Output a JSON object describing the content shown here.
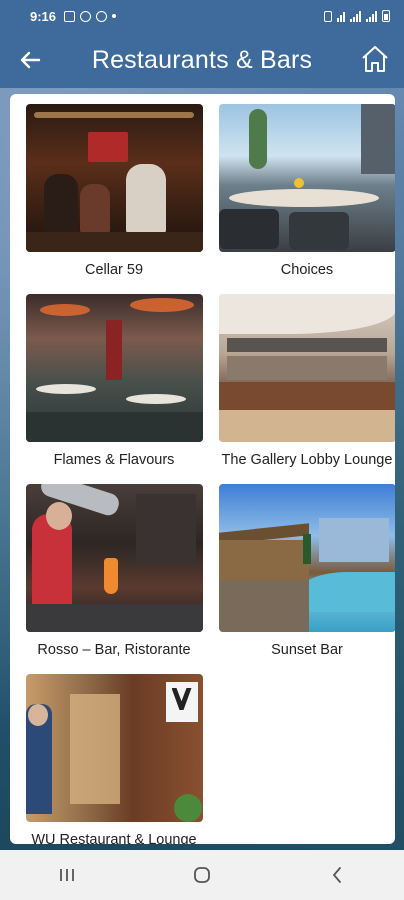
{
  "status_bar": {
    "time": "9:16"
  },
  "app_bar": {
    "title": "Restaurants & Bars",
    "back_icon": "arrow-left-icon",
    "home_icon": "home-icon"
  },
  "venues": [
    {
      "name": "Cellar 59"
    },
    {
      "name": "Choices"
    },
    {
      "name": "Flames & Flavours"
    },
    {
      "name": "The Gallery Lobby Lounge"
    },
    {
      "name": "Rosso – Bar, Ristorante"
    },
    {
      "name": "Sunset Bar"
    },
    {
      "name": "WU Restaurant & Lounge"
    }
  ],
  "colors": {
    "app_bar": "#3e6a9c",
    "card": "#ffffff",
    "nav_bar": "#f1f1f1"
  },
  "nav_bar": {
    "recents_icon": "recents-icon",
    "home_icon": "circle-home-icon",
    "back_icon": "chevron-left-icon"
  }
}
